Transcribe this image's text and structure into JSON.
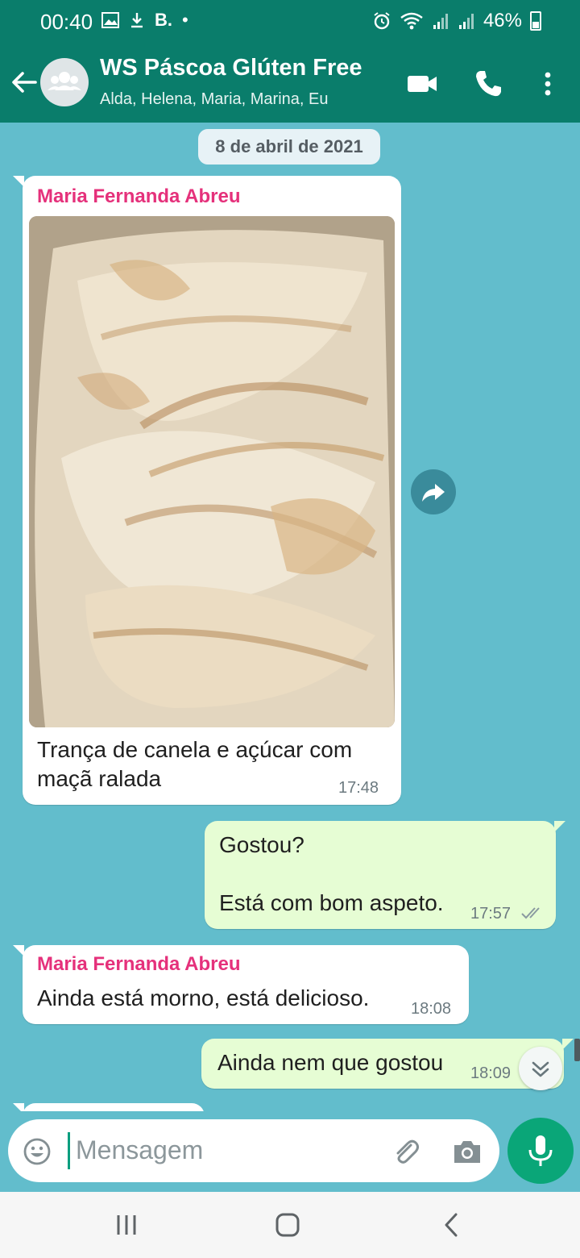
{
  "status_bar": {
    "time": "00:40",
    "letter": "B.",
    "battery": "46%"
  },
  "header": {
    "title": "WS Páscoa Glúten Free",
    "subtitle": "Alda, Helena, Maria, Marina, Eu"
  },
  "chat": {
    "date": "8 de abril de 2021",
    "messages": [
      {
        "sender": "Maria Fernanda Abreu",
        "text1": "Trança de canela e açúcar  com",
        "text2": "maçã  ralada",
        "time": "17:48"
      },
      {
        "text1": "Gostou?",
        "text2": "Está com bom aspeto.",
        "time": "17:57"
      },
      {
        "sender": "Maria Fernanda Abreu",
        "text": "Ainda está morno, está delicioso.",
        "time": "18:08"
      },
      {
        "text": "Ainda nem que gostou",
        "time": "18:09"
      }
    ]
  },
  "input": {
    "placeholder": "Mensagem"
  },
  "colors": {
    "header": "#0a7d6b",
    "chat_bg": "#62bdcc",
    "outgoing": "#e6fdd4",
    "sender": "#e5317b",
    "mic": "#0aa678"
  },
  "icons": [
    "back-arrow-icon",
    "group-avatar-icon",
    "video-call-icon",
    "phone-call-icon",
    "more-options-icon",
    "forward-icon",
    "scroll-down-icon",
    "emoji-icon",
    "attach-icon",
    "camera-icon",
    "mic-icon"
  ]
}
